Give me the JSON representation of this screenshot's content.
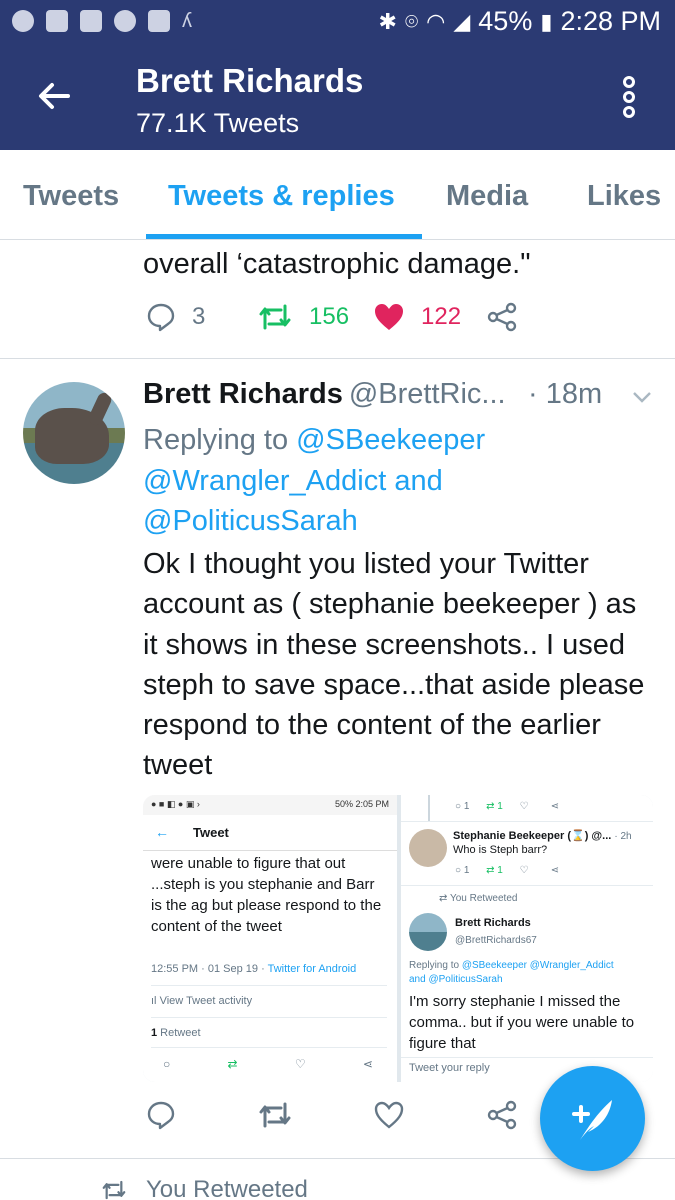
{
  "status_bar": {
    "battery": "45%",
    "time": "2:28 PM"
  },
  "app_bar": {
    "title": "Brett Richards",
    "subtitle": "77.1K Tweets"
  },
  "tabs": [
    "Tweets",
    "Tweets & replies",
    "Media",
    "Likes"
  ],
  "active_tab": "Tweets & replies",
  "previous_tweet": {
    "text_fragment": "overall ‘catastrophic damage.\"",
    "replies": "3",
    "retweets": "156",
    "likes": "122"
  },
  "tweet": {
    "name": "Brett Richards",
    "handle": "@BrettRic...",
    "time": "· 18m",
    "replying_prefix": "Replying to ",
    "mentions": [
      "@SBeekeeper",
      "@Wrangler_Addict",
      "@PoliticusSarah"
    ],
    "and": " and",
    "body": "Ok I thought you listed your Twitter account as ( stephanie beekeeper ) as it shows in these screenshots.. I used steph to save space...that aside please respond to the content of the earlier tweet"
  },
  "screenshot_left": {
    "status_time": "50% 2:05 PM",
    "header": "Tweet",
    "text": "were unable to figure that out ...steph is you stephanie and Barr is the ag but please respond to the content of the tweet",
    "meta_time": "12:55 PM · 01 Sep 19 · ",
    "meta_source": "Twitter for Android",
    "activity": "View Tweet activity",
    "retweet_count": "1",
    "retweet_label": " Retweet"
  },
  "screenshot_right": {
    "top_reply_count": "1",
    "top_rt_count": "1",
    "steph_name": "Stephanie Beekeeper (⌛) @...",
    "steph_time": "· 2h",
    "steph_text": "Who is Steph barr?",
    "steph_reply_count": "1",
    "steph_rt_count": "1",
    "you_retweeted": "You Retweeted",
    "brett_name": "Brett Richards",
    "brett_handle": "@BrettRichards67",
    "replying_prefix": "Replying to ",
    "replying_mentions": "@SBeekeeper @Wrangler_Addict",
    "replying_and": "and ",
    "replying_last": "@PoliticusSarah",
    "text": "I'm sorry stephanie I missed the  comma.. but if you were unable to figure that",
    "reply_placeholder": "Tweet your reply"
  },
  "footer": {
    "you_retweeted": "You Retweeted"
  },
  "colors": {
    "app_bar": "#2b3a73",
    "accent": "#1da1f2",
    "retweet": "#17bf63",
    "like": "#e0245e",
    "secondary_text": "#657786"
  },
  "icons": [
    "back-arrow-icon",
    "more-vertical-icon",
    "reply-icon",
    "retweet-icon",
    "heart-icon",
    "share-icon",
    "chevron-down-icon",
    "compose-icon"
  ]
}
